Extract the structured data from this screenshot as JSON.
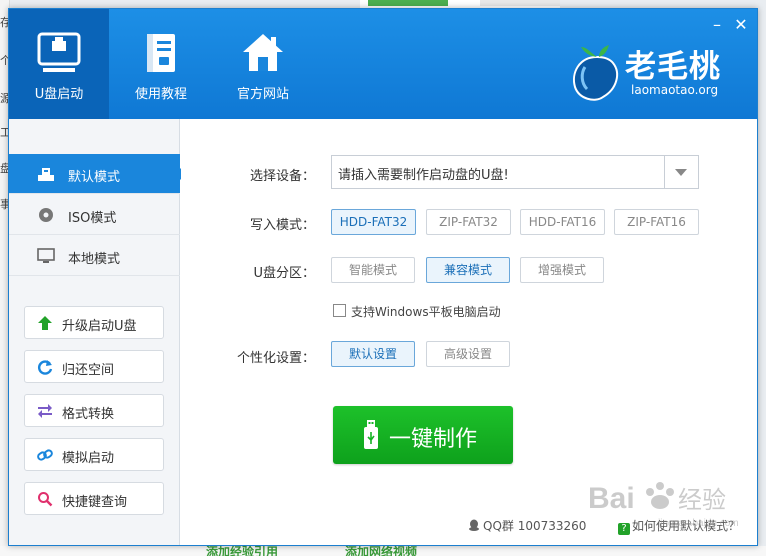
{
  "background": {
    "left_chars": [
      "存",
      "个",
      "源",
      "工",
      "盘",
      "事"
    ],
    "bottom_left_text": "添加经验引用",
    "bottom_right_text": "添加网络视频"
  },
  "window": {
    "controls": {
      "minimize": "–",
      "close": "✕"
    }
  },
  "header": {
    "nav": [
      {
        "label": "U盘启动",
        "icon": "usb-drive-icon",
        "active": true
      },
      {
        "label": "使用教程",
        "icon": "book-icon",
        "active": false
      },
      {
        "label": "官方网站",
        "icon": "home-icon",
        "active": false
      }
    ],
    "logo": {
      "name": "老毛桃",
      "url": "laomaotao.org",
      "icon": "peach-logo-icon"
    }
  },
  "sidebar": {
    "modes": [
      {
        "label": "默认模式",
        "icon": "usb-icon",
        "active": true
      },
      {
        "label": "ISO模式",
        "icon": "disc-icon",
        "active": false
      },
      {
        "label": "本地模式",
        "icon": "monitor-icon",
        "active": false
      }
    ],
    "tools": [
      {
        "label": "升级启动U盘",
        "icon": "arrow-up-icon"
      },
      {
        "label": "归还空间",
        "icon": "refresh-icon"
      },
      {
        "label": "格式转换",
        "icon": "swap-icon"
      },
      {
        "label": "模拟启动",
        "icon": "link-icon"
      },
      {
        "label": "快捷键查询",
        "icon": "search-icon"
      }
    ]
  },
  "main": {
    "device": {
      "label": "选择设备：",
      "value": "请插入需要制作启动盘的U盘!"
    },
    "write_mode": {
      "label": "写入模式：",
      "options": [
        "HDD-FAT32",
        "ZIP-FAT32",
        "HDD-FAT16",
        "ZIP-FAT16"
      ],
      "selected": "HDD-FAT32"
    },
    "partition": {
      "label": "U盘分区：",
      "options": [
        "智能模式",
        "兼容模式",
        "增强模式"
      ],
      "selected": "兼容模式"
    },
    "tablet_checkbox": {
      "label": "支持Windows平板电脑启动",
      "checked": false
    },
    "personalize": {
      "label": "个性化设置：",
      "options": [
        "默认设置",
        "高级设置"
      ],
      "selected": "默认设置"
    },
    "make_button": "一键制作"
  },
  "footer": {
    "qq": "QQ群 100733260",
    "help": "如何使用默认模式？",
    "help_icon_char": "?"
  },
  "watermark": {
    "text": "Bai 经验",
    "sub": "jingyan.baidu.com"
  },
  "colors": {
    "header_blue": "#1086dc",
    "active_blue": "#1a86dc",
    "make_green": "#16b425",
    "selected_border": "#6aa7da"
  }
}
